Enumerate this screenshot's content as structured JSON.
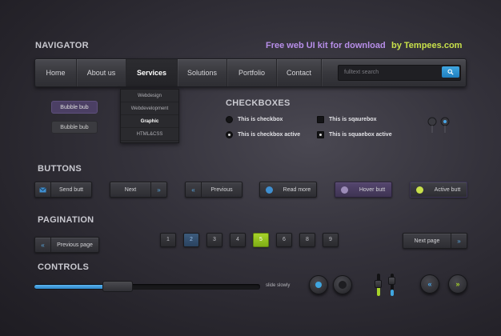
{
  "header": {
    "title": "NAVIGATOR",
    "promo_text": "Free web UI kit for download",
    "promo_author": "by Tempees.com"
  },
  "nav": {
    "items": [
      {
        "label": "Home"
      },
      {
        "label": "About us"
      },
      {
        "label": "Services"
      },
      {
        "label": "Solutions"
      },
      {
        "label": "Portfolio"
      },
      {
        "label": "Contact"
      }
    ],
    "active_index": 2,
    "search_placeholder": "fulltext search"
  },
  "dropdown": {
    "items": [
      "Webdesign",
      "Webdevelopment",
      "Graphic",
      "HTML&CSS"
    ],
    "bold_index": 2
  },
  "bubbles": [
    "Bubble bub",
    "Bubble bub"
  ],
  "checkboxes": {
    "title": "CHECKBOXES",
    "items": [
      {
        "label": "This is checkbox",
        "checked": false
      },
      {
        "label": "This is sqaurebox",
        "checked": false
      },
      {
        "label": "This is checkbox active",
        "checked": true
      },
      {
        "label": "This is squaebox active",
        "checked": true
      }
    ]
  },
  "buttons": {
    "title": "BUTTONS",
    "items": [
      {
        "label": "Send butt",
        "icon": "mail-icon"
      },
      {
        "label": "Next",
        "icon": "double-chevron-right-icon"
      },
      {
        "label": "Previous",
        "icon": "double-chevron-left-icon"
      },
      {
        "label": "Read more",
        "icon": "info-circle-icon"
      },
      {
        "label": "Hover butt",
        "icon": "info-circle-icon"
      },
      {
        "label": "Active butt",
        "icon": "info-circle-icon"
      }
    ]
  },
  "pagination": {
    "title": "PAGINATION",
    "previous_label": "Previous page",
    "next_label": "Next page",
    "pages": [
      "1",
      "2",
      "3",
      "4",
      "5",
      "6",
      "8",
      "9"
    ],
    "visited_page": "2",
    "current_page": "5"
  },
  "controls": {
    "title": "CONTROLS",
    "slider_label": "slide slowly",
    "slider_value_fraction": 0.31
  },
  "colors": {
    "accent_blue": "#3fa6e0",
    "accent_green": "#a7d42a",
    "accent_purple": "#b78ee8",
    "promo_green": "#c8e04a"
  }
}
